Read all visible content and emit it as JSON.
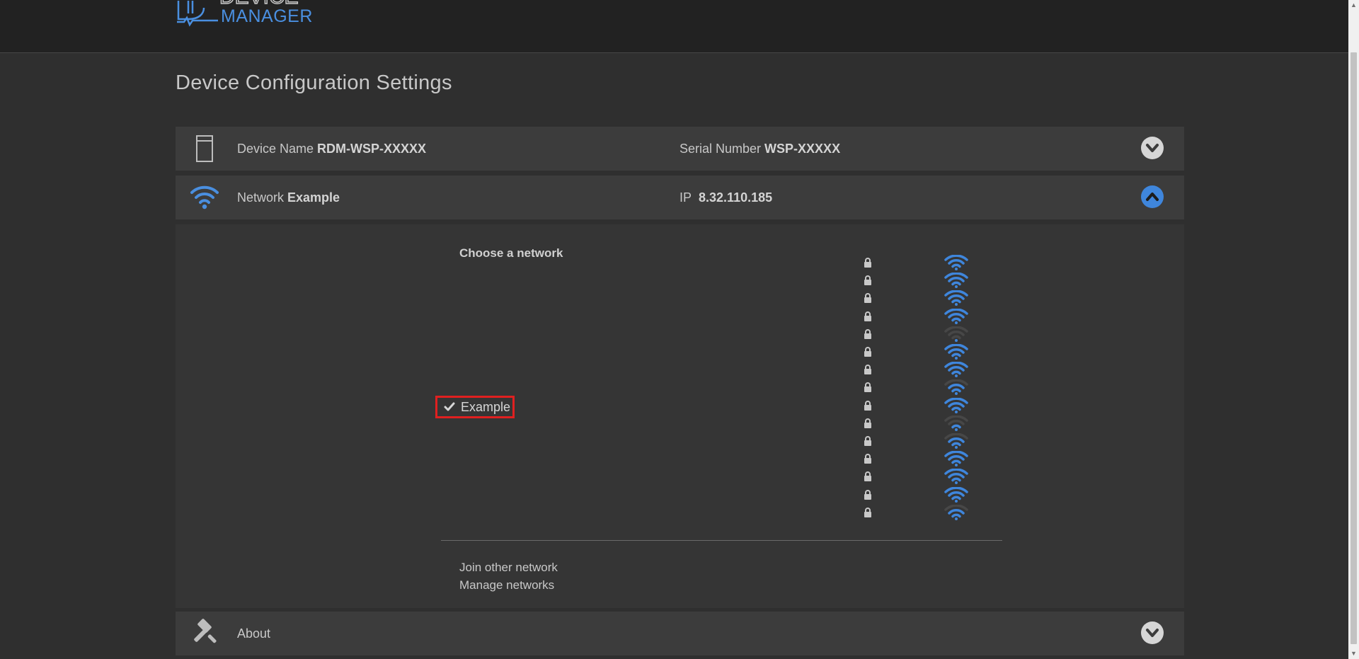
{
  "header": {
    "logo_word_top": "DEVICE",
    "logo_word_bottom": "MANAGER"
  },
  "page_title": "Device Configuration Settings",
  "device_panel": {
    "name_label": "Device Name",
    "name_value": "RDM-WSP-XXXXX",
    "serial_label": "Serial Number",
    "serial_value": "WSP-XXXXX",
    "icon": "device-icon",
    "toggle_icon": "chevron-down-icon"
  },
  "network_panel": {
    "network_label": "Network",
    "network_value": "Example",
    "ip_label": "IP",
    "ip_value": "8.32.110.185",
    "icon": "wifi-icon",
    "toggle_icon": "chevron-up-icon"
  },
  "network_chooser": {
    "heading": "Choose a network",
    "selected_network": "Example",
    "networks": [
      {
        "name": "",
        "secured": true,
        "signal_bars": 4
      },
      {
        "name": "",
        "secured": true,
        "signal_bars": 4
      },
      {
        "name": "",
        "secured": true,
        "signal_bars": 4
      },
      {
        "name": "",
        "secured": true,
        "signal_bars": 4
      },
      {
        "name": "",
        "secured": true,
        "signal_bars": 1
      },
      {
        "name": "",
        "secured": true,
        "signal_bars": 4
      },
      {
        "name": "",
        "secured": true,
        "signal_bars": 4
      },
      {
        "name": "",
        "secured": true,
        "signal_bars": 3
      },
      {
        "name": "Example",
        "secured": true,
        "signal_bars": 4,
        "selected": true
      },
      {
        "name": "",
        "secured": true,
        "signal_bars": 2
      },
      {
        "name": "",
        "secured": true,
        "signal_bars": 3
      },
      {
        "name": "",
        "secured": true,
        "signal_bars": 4
      },
      {
        "name": "",
        "secured": true,
        "signal_bars": 4
      },
      {
        "name": "",
        "secured": true,
        "signal_bars": 4
      },
      {
        "name": "",
        "secured": true,
        "signal_bars": 3
      }
    ],
    "join_other_label": "Join other network",
    "manage_label": "Manage networks"
  },
  "about_panel": {
    "label": "About",
    "icon": "gavel-icon",
    "toggle_icon": "chevron-down-icon"
  },
  "colors": {
    "accent_blue": "#3f86dc",
    "highlight_red": "#e02020",
    "background": "#2f2f2f",
    "panel": "#3c3c3c"
  }
}
